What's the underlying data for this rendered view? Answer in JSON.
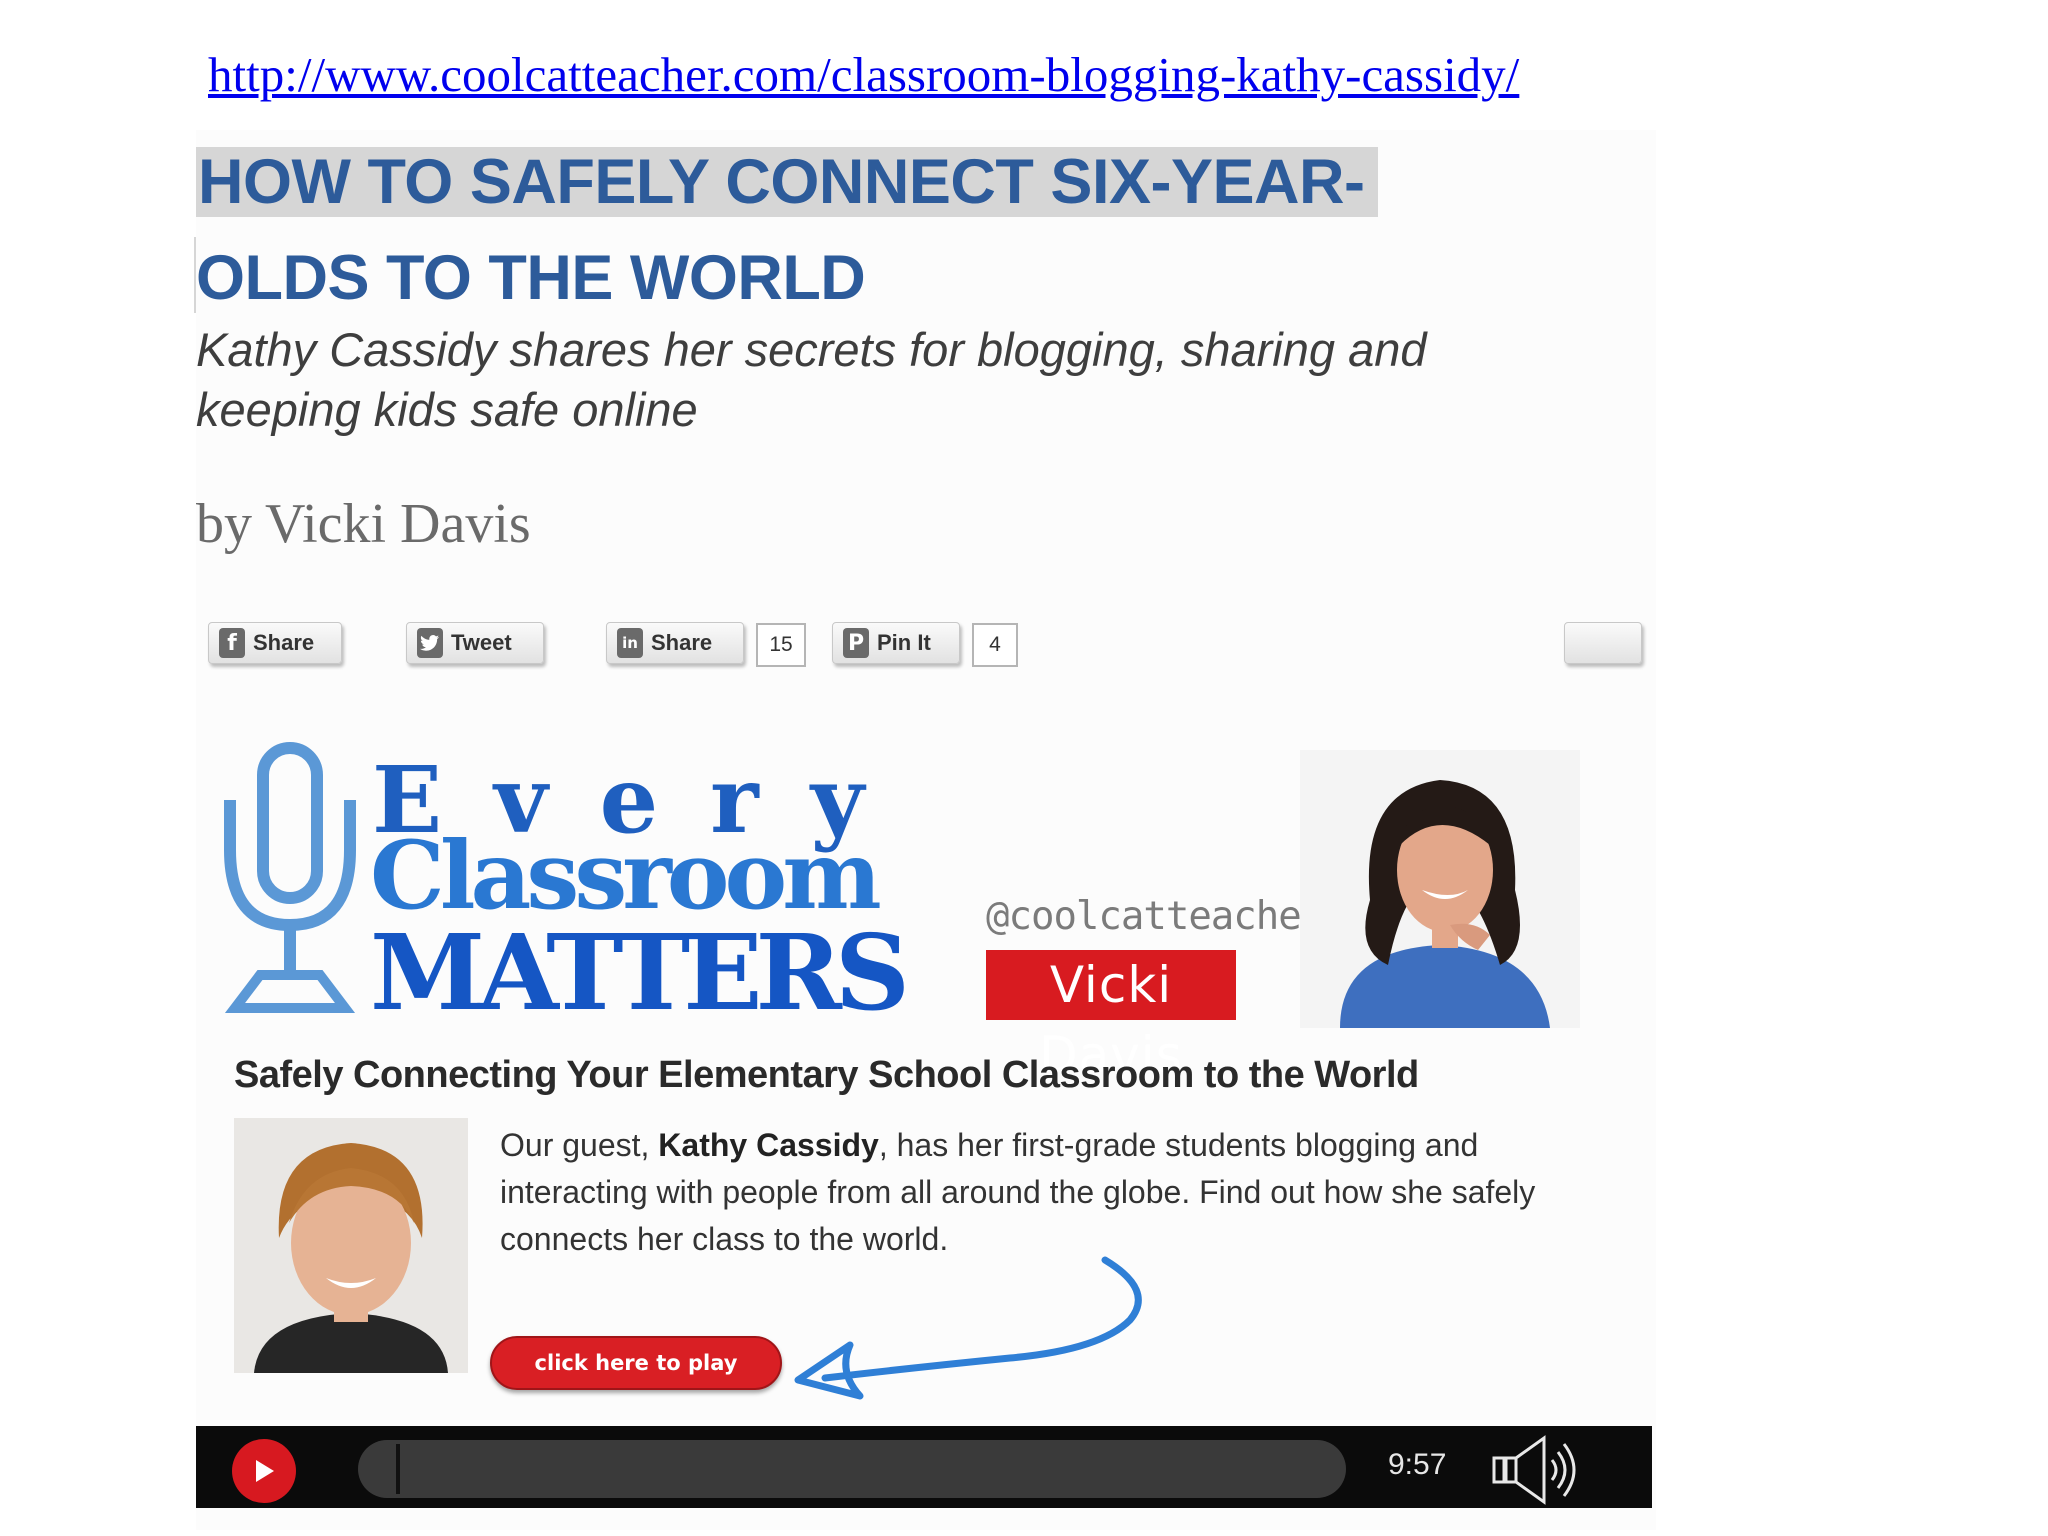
{
  "url": "http://www.coolcatteacher.com/classroom-blogging-kathy-cassidy/",
  "article": {
    "headline_line1": "HOW TO SAFELY CONNECT SIX-YEAR-",
    "headline_line2": "OLDS TO THE WORLD",
    "subtitle": "Kathy Cassidy shares her secrets for blogging, sharing and keeping kids safe online",
    "byline": "by Vicki Davis"
  },
  "share_bar": {
    "facebook_share_label": "Share",
    "tweet_label": "Tweet",
    "linkedin_share_label": "Share",
    "linkedin_share_count": "15",
    "pinterest_label": "Pin It",
    "pinterest_count": "4",
    "facebook_icon": "f",
    "linkedin_icon": "in",
    "pinterest_icon": "P"
  },
  "banner": {
    "every": "Every",
    "classroom": "Classroom",
    "matters": "MATTERS",
    "handle": "@coolcatteacher",
    "host_name": "Vicki Davis",
    "colors": {
      "brand_blue": "#1f5fbf",
      "brand_red": "#d81b20"
    }
  },
  "episode": {
    "title": "Safely Connecting Your Elementary School Classroom to the World",
    "desc_intro": "Our guest, ",
    "guest_name": "Kathy Cassidy",
    "desc_rest": ", has her first-grade students blogging and interacting with people from all around the globe. Find out how she safely connects her class to the world.",
    "play_cta": "click here to play"
  },
  "player": {
    "duration": "9:57",
    "icons": {
      "play": "play-icon",
      "volume": "volume-icon"
    },
    "accent": "#d71920"
  }
}
